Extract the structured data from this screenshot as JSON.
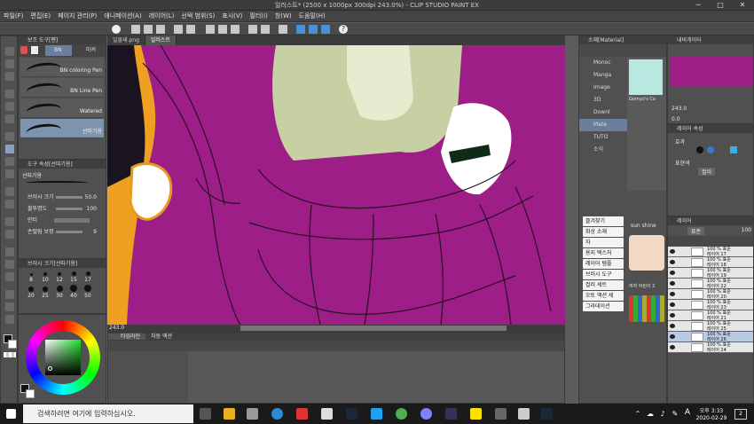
{
  "window": {
    "title": "일러스트* (2500 x 1000px 300dpi 243.0%) - CLIP STUDIO PAINT EX"
  },
  "menu": [
    "파일(F)",
    "편집(E)",
    "페이지 관리(P)",
    "애니메이션(A)",
    "레이어(L)",
    "선택 범위(S)",
    "표시(V)",
    "필터(I)",
    "창(W)",
    "도움말(H)"
  ],
  "sub_tool": {
    "header": "보조 도구[펜]",
    "tabs": [
      "BN",
      "마커"
    ],
    "items": [
      "BN coloring Pen",
      "BN Line Pen",
      "Watered",
      "선따기용"
    ]
  },
  "tool_property": {
    "header": "도구 속성[선따기용]",
    "name": "선따기용",
    "brush_size_label": "브러시 크기",
    "brush_size_value": "50.0",
    "opacity_label": "불투명도",
    "opacity_value": "100",
    "aa_label": "안티",
    "stabilization_label": "손떨림 보정",
    "stabilization_value": "9"
  },
  "brush_size_palette": {
    "header": "브러시 크기[선따기용]",
    "sizes": [
      "8",
      "10",
      "12",
      "15",
      "17",
      "20",
      "25",
      "30",
      "40",
      "50"
    ]
  },
  "canvas_tabs": [
    "일물새.png",
    "일러스트"
  ],
  "zoom_readout": "243.0",
  "timeline": {
    "tabs": [
      "타임라인",
      "자동 액션"
    ]
  },
  "material": {
    "header": "소재[Material]",
    "items": [
      "Monoc",
      "Manga",
      "Image",
      "3D",
      "Downl",
      "Mate",
      "TUTO",
      "소식"
    ],
    "quick_buttons": [
      "즐겨찾기",
      "화상 소재",
      "자",
      "용지 텍스처",
      "레이어 템플",
      "브러시 도구",
      "컬러 세트",
      "오토 액션 세",
      "그라데이션"
    ],
    "thumb_label_1": "Gomyo's Co",
    "thumb_label_2": "sun shine",
    "thumb_label_3": "여자 어린이 2"
  },
  "navigator": {
    "header": "내비게이터",
    "zoom": "243.0",
    "rotation": "0.0"
  },
  "layer_property": {
    "header": "레이어 속성",
    "effect_label": "효과",
    "expression_label": "표현색",
    "expression_value": "컬러"
  },
  "layers": {
    "header": "레이어",
    "blend_mode": "표준",
    "opacity": "100",
    "items": [
      {
        "pct": "100 % 표준",
        "name": "레이어 17"
      },
      {
        "pct": "100 % 표준",
        "name": "레이어 18"
      },
      {
        "pct": "100 % 표준",
        "name": "레이어 19"
      },
      {
        "pct": "100 % 표준",
        "name": "레이어 22"
      },
      {
        "pct": "100 % 표준",
        "name": "레이어 20"
      },
      {
        "pct": "100 % 표준",
        "name": "레이어 23"
      },
      {
        "pct": "100 % 표준",
        "name": "레이어 21"
      },
      {
        "pct": "100 % 표준",
        "name": "레이어 25"
      },
      {
        "pct": "100 % 표준",
        "name": "레이어 26"
      },
      {
        "pct": "100 % 표준",
        "name": "레이어 24"
      }
    ]
  },
  "taskbar": {
    "search_placeholder": "검색하려면 여기에 입력하십시오.",
    "ime": "A",
    "time": "오후 3:33",
    "date": "2020-02-29",
    "notif_count": "2"
  },
  "colors": {
    "canvas_bg": "#9c1e86",
    "panel": "#505050",
    "accent": "#6b7f9c"
  }
}
